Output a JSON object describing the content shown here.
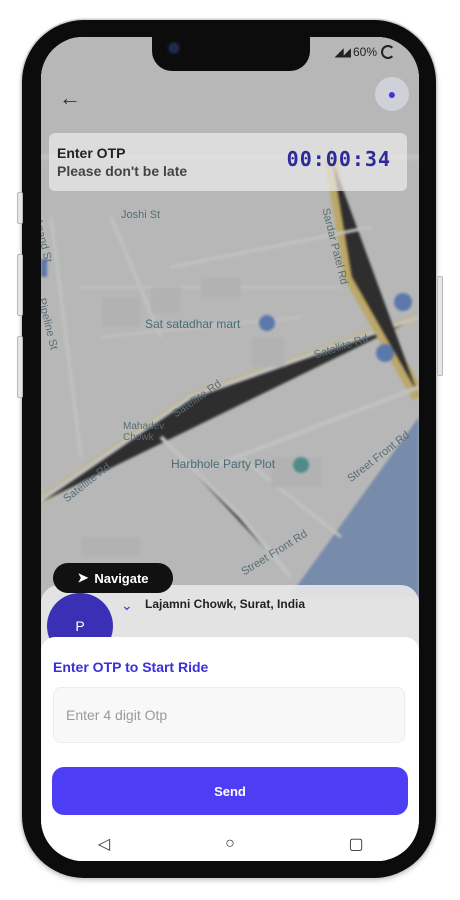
{
  "status": {
    "battery_percent": "60%"
  },
  "header": {
    "back_icon": "back-arrow-icon",
    "bell_icon": "bell-icon"
  },
  "otp_card": {
    "title": "Enter OTP",
    "subtitle": "Please don't be late",
    "timer": "00:00:34"
  },
  "map_labels": {
    "joshi_st": "Joshi St",
    "sardar_patel_rd": "Sardar Patel Rd",
    "sat_satadhar_mart": "Sat satadhar mart",
    "satellite_rd_1": "Satellite Rd",
    "satellite_rd_2": "Satellite Rd",
    "satellite_rd_3": "Satellite Rd",
    "mahadev_chowk": "Mahadev Chowk",
    "harbhole_party_plot": "Harbhole Party Plot",
    "street_front_rd_1": "Street Front Rd",
    "street_front_rd_2": "Street Front Rd",
    "anand_st": "Anand St",
    "pipeline_st": "Pipeline St"
  },
  "navigate": {
    "label": "Navigate"
  },
  "ride": {
    "avatar_letter": "P",
    "pickup": "Lajamni Chowk, Surat, India"
  },
  "sheet": {
    "title": "Enter OTP to Start Ride",
    "otp_placeholder": "Enter 4 digit Otp",
    "send_label": "Send"
  },
  "colors": {
    "accent": "#4d3ef6",
    "accent_dark": "#3a2fd8",
    "road_major": "#f2d36b",
    "water": "#7fa0d6"
  }
}
